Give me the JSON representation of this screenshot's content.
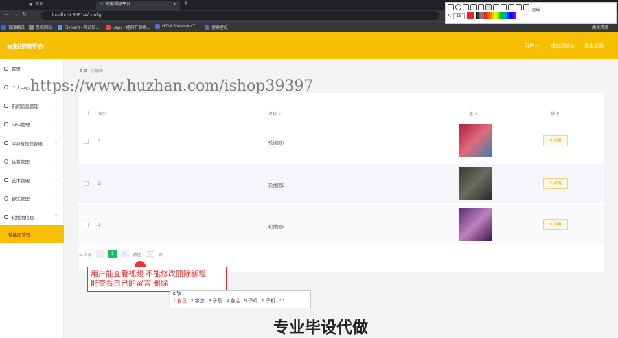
{
  "browser": {
    "tabs": [
      {
        "title": "首页"
      },
      {
        "title": "光影视频平台"
      }
    ],
    "url": "localhost:8081/#/config",
    "bookmarks": [
      "百度翻译",
      "思维网站",
      "Element - 网站快...",
      "Layui - 经典开源模...",
      "HTML5 Website T...",
      "搜索壁纸"
    ],
    "bookmarks_right": "阅读清单"
  },
  "header": {
    "logo": "光影视频平台",
    "user": "用户 a1",
    "exit_front": "退出到前台",
    "logout": "退出登录"
  },
  "sidebar": {
    "items": [
      {
        "label": "首页"
      },
      {
        "label": "个人中心"
      },
      {
        "label": "新闻信息管理"
      },
      {
        "label": "NBA管理"
      },
      {
        "label": "papi酱视频管理"
      },
      {
        "label": "体育管理"
      },
      {
        "label": "艺术管理"
      },
      {
        "label": "娱乐管理"
      },
      {
        "label": "轮播图信息"
      },
      {
        "label": "轮播图管理"
      }
    ]
  },
  "breadcrumb": {
    "home": "首页",
    "sep": "/",
    "current": "轮播图"
  },
  "table": {
    "headers": {
      "index": "索引",
      "name": "名称",
      "value": "值",
      "actions": "操作"
    },
    "rows": [
      {
        "index": "1",
        "name": "轮播图1",
        "action": "详情"
      },
      {
        "index": "2",
        "name": "轮播图2",
        "action": "详情"
      },
      {
        "index": "3",
        "name": "轮播图3",
        "action": "详情"
      }
    ]
  },
  "pagination": {
    "total": "共 3 条",
    "current": "1",
    "goto": "前往",
    "goto_value": "1",
    "page_unit": "页"
  },
  "annotation": {
    "line1": "用户能查看视频 不能修改删除新增",
    "line2": "能查看自己的留言 删除"
  },
  "ime": {
    "input": "zi'ji",
    "candidates": [
      "1.自己",
      "2.字迹",
      "3.子集",
      "4.自给",
      "5.仔鸡",
      "6.子机"
    ]
  },
  "watermark": "https://www.huzhan.com/ishop39397",
  "caption": "专业毕设代做",
  "screenshot_toolbar": {
    "font_size": "18",
    "finish": "完成"
  }
}
